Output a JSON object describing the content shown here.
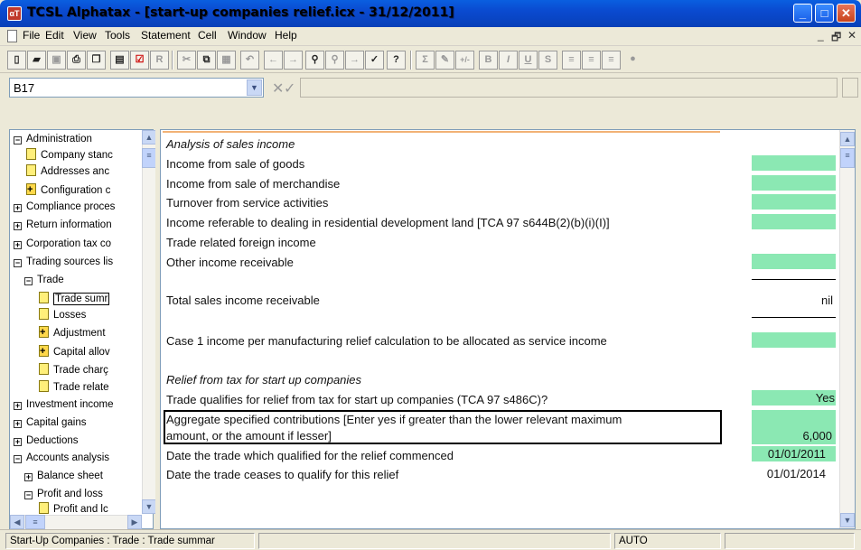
{
  "window": {
    "title": "TCSL Alphatax - [start-up companies relief.icx - 31/12/2011]",
    "controls": {
      "minimize": "_",
      "maximize": "□",
      "close": "✕"
    }
  },
  "menu": [
    "File",
    "Edit",
    "View",
    "Tools",
    "Statement",
    "Cell",
    "Window",
    "Help"
  ],
  "mdi_controls": {
    "minimize": "_",
    "restore": "🗗",
    "close": "✕"
  },
  "toolbar": {
    "buttons": [
      "new",
      "open",
      "save",
      "print",
      "copy-sheet",
      "preview",
      "check",
      "R",
      "cut",
      "copy",
      "paste",
      "undo",
      "back",
      "forward",
      "find",
      "find-next",
      "goto",
      "spell",
      "help",
      "sum",
      "edit",
      "plus-minus",
      "B",
      "I",
      "U",
      "S",
      "align-left",
      "align-center",
      "align-right"
    ],
    "labels": {
      "R": "R",
      "B": "B",
      "I": "I",
      "U": "U",
      "S": "S",
      "sum": "Σ",
      "plusminus": "+/-"
    }
  },
  "formula_bar": {
    "cell_ref": "B17",
    "cancel": "✕",
    "ok": "✓",
    "content": ""
  },
  "tree": [
    {
      "label": "Administration",
      "state": "minus",
      "level": 0
    },
    {
      "label": "Company stanc",
      "icon": "page",
      "level": 1
    },
    {
      "label": "Addresses anc",
      "icon": "page",
      "level": 1
    },
    {
      "label": "Configuration c",
      "icon": "page-plus",
      "level": 1
    },
    {
      "label": "Compliance proces",
      "state": "plus",
      "level": 0
    },
    {
      "label": "Return information",
      "state": "plus",
      "level": 0
    },
    {
      "label": "Corporation tax co",
      "state": "plus",
      "level": 0
    },
    {
      "label": "Trading sources lis",
      "state": "minus",
      "level": 0
    },
    {
      "label": "Trade",
      "state": "minus",
      "level": 1
    },
    {
      "label": "Trade sumr",
      "icon": "page",
      "level": 2,
      "selected": true
    },
    {
      "label": "Losses",
      "icon": "page",
      "level": 2
    },
    {
      "label": "Adjustment",
      "icon": "page-plus",
      "level": 2
    },
    {
      "label": "Capital allov",
      "icon": "page-plus",
      "level": 2
    },
    {
      "label": "Trade charç",
      "icon": "page",
      "level": 2
    },
    {
      "label": "Trade relate",
      "icon": "page",
      "level": 2
    },
    {
      "label": "Investment income",
      "state": "plus",
      "level": 0
    },
    {
      "label": "Capital gains",
      "state": "plus",
      "level": 0
    },
    {
      "label": "Deductions",
      "state": "plus",
      "level": 0
    },
    {
      "label": "Accounts analysis",
      "state": "minus",
      "level": 0
    },
    {
      "label": "Balance sheet",
      "state": "plus",
      "level": 1
    },
    {
      "label": "Profit and loss",
      "state": "minus",
      "level": 1
    },
    {
      "label": "Profit and lc",
      "icon": "page",
      "level": 2
    }
  ],
  "sheet": {
    "rows": [
      {
        "label": "Analysis of sales income",
        "italic": true
      },
      {
        "label": "Income from sale of goods",
        "green": true
      },
      {
        "label": "Income from sale of merchandise",
        "green": true
      },
      {
        "label": "Turnover from service activities",
        "green": true
      },
      {
        "label": "Income referable to dealing in residential development land [TCA 97 s644B(2)(b)(i)(I)]",
        "green": true
      },
      {
        "label": "Trade related foreign income"
      },
      {
        "label": "Other income receivable",
        "green": true
      },
      {
        "label": "Total sales income receivable",
        "value": "nil"
      },
      {
        "label": "Case 1 income per manufacturing relief calculation to be allocated as service income",
        "green": true
      },
      {
        "label": "Relief from tax for start up companies",
        "italic": true
      },
      {
        "label": "Trade qualifies for relief from tax for start up companies (TCA 97 s486C)?",
        "value": "Yes",
        "green": true
      },
      {
        "label_line1": "Aggregate specified contributions [Enter yes if greater than the lower relevant maximum",
        "label_line2": "amount, or the amount if lesser]",
        "value": "6,000",
        "green": true
      },
      {
        "label": "Date the trade which qualified for the relief commenced",
        "value": "01/01/2011",
        "green": true
      },
      {
        "label": "Date the trade ceases to qualify for this relief",
        "value": "01/01/2014"
      }
    ]
  },
  "status": {
    "left": "Start-Up Companies : Trade : Trade summar",
    "mode": "AUTO"
  },
  "colors": {
    "input_cell": "#8be8b3",
    "title_bar": "#0a4ad0",
    "accent_line": "#f2b276"
  }
}
